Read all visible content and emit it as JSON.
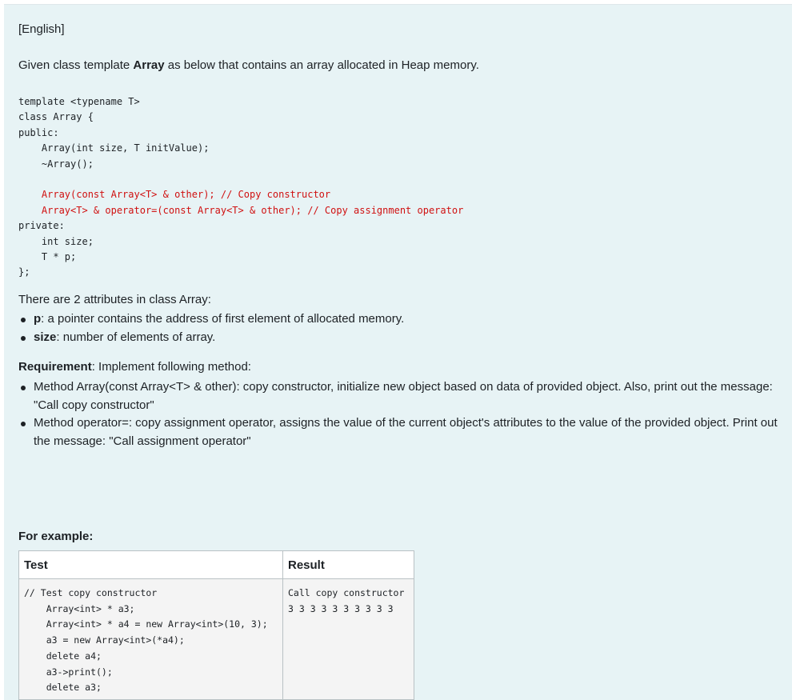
{
  "language_tag": "[English]",
  "intro": {
    "before": "Given class template ",
    "bold": "Array",
    "after": " as below that contains an array allocated in Heap memory."
  },
  "code_lines": [
    "template <typename T>",
    "class Array {",
    "public:",
    "    Array(int size, T initValue);",
    "    ~Array();",
    "",
    "    Array(const Array<T> & other); // Copy constructor",
    "    Array<T> & operator=(const Array<T> & other); // Copy assignment operator",
    "private:",
    "    int size;",
    "    T * p;",
    "};"
  ],
  "attributes": {
    "title": "There are 2 attributes in class Array:",
    "items": [
      {
        "name": "p",
        "desc": ": a pointer contains the address of first element of allocated memory."
      },
      {
        "name": "size",
        "desc": ": number of elements of array."
      }
    ]
  },
  "requirement": {
    "label": "Requirement",
    "text": ": Implement following method:",
    "items": [
      "Method Array(const Array<T> & other): copy constructor, initialize new object based on data of provided object. Also, print out the message: \"Call copy constructor\"",
      "Method operator=: copy assignment operator, assigns the value of the current object's attributes to the value of the provided object. Print out the message: \"Call assignment operator\""
    ]
  },
  "example": {
    "title": "For example:",
    "headers": [
      "Test",
      "Result"
    ],
    "test_code": "// Test copy constructor\n    Array<int> * a3;\n    Array<int> * a4 = new Array<int>(10, 3);\n    a3 = new Array<int>(*a4);\n    delete a4;\n    a3->print();\n    delete a3;",
    "result": "Call copy constructor\n3 3 3 3 3 3 3 3 3 3"
  }
}
